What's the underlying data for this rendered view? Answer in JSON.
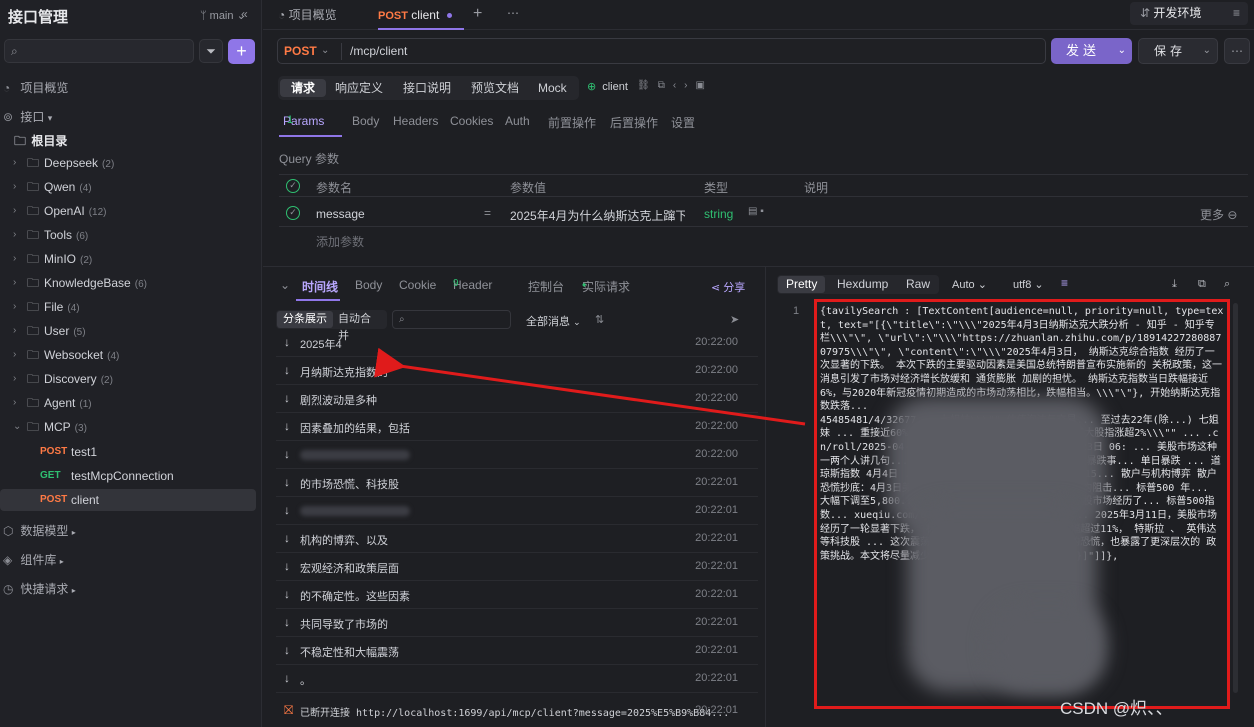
{
  "sidebar": {
    "title": "接口管理",
    "branch": "main",
    "sections": {
      "overview": "项目概览",
      "api": "接口",
      "root": "根目录",
      "datamodel": "数据模型",
      "components": "组件库",
      "quick": "快捷请求"
    },
    "folders": [
      {
        "name": "Deepseek",
        "count": "(2)"
      },
      {
        "name": "Qwen",
        "count": "(4)"
      },
      {
        "name": "OpenAI",
        "count": "(12)"
      },
      {
        "name": "Tools",
        "count": "(6)"
      },
      {
        "name": "MinIO",
        "count": "(2)"
      },
      {
        "name": "KnowledgeBase",
        "count": "(6)"
      },
      {
        "name": "File",
        "count": "(4)"
      },
      {
        "name": "User",
        "count": "(5)"
      },
      {
        "name": "Websocket",
        "count": "(4)"
      },
      {
        "name": "Discovery",
        "count": "(2)"
      },
      {
        "name": "Agent",
        "count": "(1)"
      },
      {
        "name": "MCP",
        "count": "(3)"
      }
    ],
    "endpoints": [
      {
        "method": "POST",
        "name": "test1"
      },
      {
        "method": "GET",
        "name": "testMcpConnection"
      },
      {
        "method": "POST",
        "name": "client"
      }
    ]
  },
  "tabs": {
    "overview": "项目概览",
    "current_method": "POST",
    "current_name": "client",
    "env": "开发环境"
  },
  "request": {
    "method": "POST",
    "url": "/mcp/client",
    "send": "发送",
    "save": "保存",
    "seg": [
      "请求",
      "响应定义",
      "接口说明",
      "预览文档",
      "Mock"
    ],
    "client": "client",
    "tabs": [
      "Params",
      "Body",
      "Headers",
      "Cookies",
      "Auth",
      "前置操作",
      "后置操作",
      "设置"
    ],
    "params_count": "1",
    "query_label": "Query 参数",
    "head": {
      "name": "参数名",
      "value": "参数值",
      "type": "类型",
      "desc": "说明"
    },
    "row": {
      "name": "message",
      "eq": "=",
      "value": "2025年4月为什么纳斯达克上蹿下跳",
      "type": "string",
      "more": "更多"
    },
    "add_param": "添加参数"
  },
  "timeline": {
    "tabs": [
      "时间线",
      "Body",
      "Cookie",
      "Header",
      "控制台",
      "实际请求"
    ],
    "header_count": "9",
    "share": "分享",
    "seg": [
      "分条展示",
      "自动合并"
    ],
    "all_msgs": "全部消息",
    "rows": [
      {
        "text": "2025年4",
        "time": "20:22:00"
      },
      {
        "text": "月纳斯达克指数的",
        "time": "20:22:00"
      },
      {
        "text": "剧烈波动是多种",
        "time": "20:22:00"
      },
      {
        "text": "因素叠加的结果，包括",
        "time": "20:22:00"
      },
      {
        "text": "",
        "time": "20:22:00"
      },
      {
        "text": "的市场恐慌、科技股",
        "time": "20:22:01"
      },
      {
        "text": "",
        "time": "20:22:01"
      },
      {
        "text": "机构的博弈、以及",
        "time": "20:22:01"
      },
      {
        "text": "宏观经济和政策层面",
        "time": "20:22:01"
      },
      {
        "text": "的不确定性。这些因素",
        "time": "20:22:01"
      },
      {
        "text": "共同导致了市场的",
        "time": "20:22:01"
      },
      {
        "text": "不稳定性和大幅震荡",
        "time": "20:22:01"
      },
      {
        "text": "。",
        "time": "20:22:01"
      }
    ],
    "last": {
      "text": "已断开连接 http://localhost:1699/api/mcp/client?message=2025%E5%B9%B84...",
      "time": "20:22:01"
    }
  },
  "response": {
    "seg": [
      "Pretty",
      "Hexdump",
      "Raw"
    ],
    "auto": "Auto",
    "enc": "utf8",
    "line": "1",
    "body": "{tavilySearch : [TextContent[audience=null, priority=null, type=text, text=\"[{\\\"title\\\":\\\"\\\\\\\"2025年4月3日纳斯达克大跌分析 - 知乎 - 知乎专栏\\\\\\\"\\\", \\\"url\\\":\\\"\\\\\\\"https://zhuanlan.zhihu.com/p/1891422728088707975\\\\\\\"\\\", \\\"content\\\":\\\"\\\\\\\"2025年4月3日， 纳斯达克综合指数 经历了一次显著的下跌。 本次下跌的主要驱动因素是美国总统特朗普宣布实施新的 关税政策，这一消息引发了市场对经济增长放缓和 通货膨胀 加剧的担忧。 纳斯达克指数当日跌幅接近6%，与2020年新冠疫情初期造成的市场动荡相比，跌幅相当。\\\\\\\"\\\"}, 开始纳斯达克指数跌落...\n45485481/4/32677... 七姐妹\\\\\\\"\" 估值泡沫与交易... 至过去22年(除...) 七姐妹 ... 重接近60%，远超合理区间 ... 发表稳市言论 三大股指涨超2%\\\\\\\"\" ... .cn/roll/2025-04-23/doc-ineuaw... \\\"2025年04月23日 06: ... 美股市场这种一两个人讲几句... \\\"title\\\":\\\" ... 2025年4月美股暴跌事... 单日暴跌 ... 道琼斯指数 4月4日 ... https://xueqiu.com/169221315... 散户与机构博弈 散户恐慌抄底：4月3日美国 ... 但次日继续暴跌导致亏损。机构阻击... 标普500 年... 大幅下调至5,800... 2025年初美股暴跌分析：暂... 美股市场经历了... 标普500指数... xueqiu.com/6308900690/326811717\\\\\\\" ... 2025年3月11日，美股市场经历了一轮显著下跌， 标普500 ... 纳斯达克指数 跌幅超过11%， 特斯拉 、 英伟达 等科技股 ... 这次震荡不仅反映了市场对短期不确定性的恐慌，也暴露了更深层次的 政策挑战。本文将尽量减少主观情绪，结合当前形势\\\\\\\"\\\"}]\"]]},"
  },
  "watermark": "CSDN @炽、、"
}
